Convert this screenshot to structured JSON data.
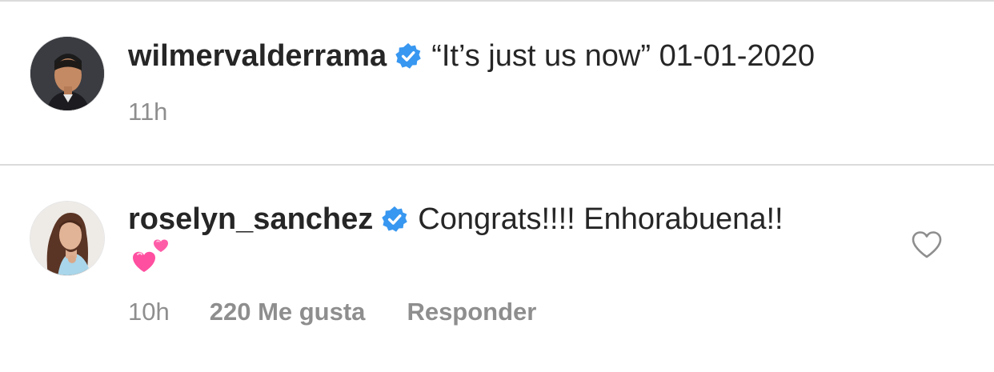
{
  "post": {
    "username": "wilmervalderrama",
    "caption": "“It’s just us now” 01-01-2020",
    "time": "11h",
    "avatar_icon": "avatar-photo",
    "verified_icon": "verified-badge-icon"
  },
  "comment": {
    "username": "roselyn_sanchez",
    "text": "Congrats!!!! Enhorabuena!!",
    "emoji": "two-hearts-emoji",
    "time": "10h",
    "likes_label": "220 Me gusta",
    "reply_label": "Responder",
    "like_icon": "heart-outline-icon",
    "avatar_icon": "avatar-photo",
    "verified_icon": "verified-badge-icon"
  },
  "colors": {
    "verified_blue": "#3897f0",
    "meta_gray": "#8e8e8e",
    "text": "#262626",
    "divider": "#dbdbdb",
    "heart_pink": "#ff5ca8"
  }
}
